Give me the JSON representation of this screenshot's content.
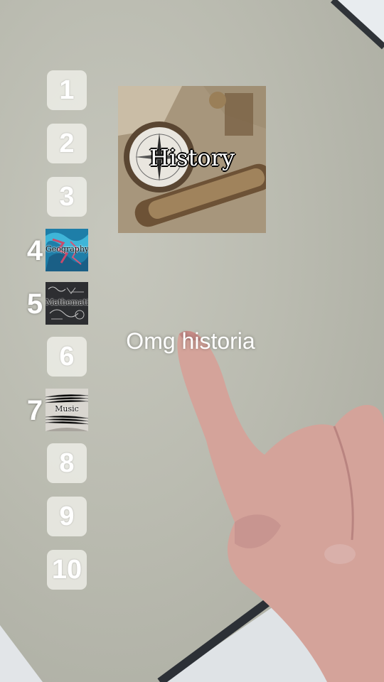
{
  "slots": [
    {
      "rank": "1"
    },
    {
      "rank": "2"
    },
    {
      "rank": "3"
    },
    {
      "rank": "4",
      "filled": true,
      "label": "Geography"
    },
    {
      "rank": "5",
      "filled": true,
      "label": "Mathematics"
    },
    {
      "rank": "6"
    },
    {
      "rank": "7",
      "filled": true,
      "label": "Music"
    },
    {
      "rank": "8"
    },
    {
      "rank": "9"
    },
    {
      "rank": "10"
    }
  ],
  "current_card": {
    "label": "History"
  },
  "caption": "Omg historia"
}
